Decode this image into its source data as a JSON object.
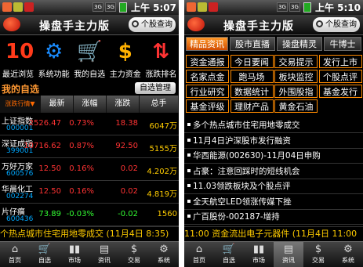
{
  "left": {
    "status_time": "上午 5:07",
    "app_title": "操盘手主力版",
    "search_label": "个股查询",
    "icons": [
      {
        "label": "最近浏览",
        "glyph": "10",
        "color": "#ff3a1a"
      },
      {
        "label": "系统功能",
        "glyph": "⚙",
        "color": "#1a8cff"
      },
      {
        "label": "我的自选",
        "glyph": "🛒",
        "color": "#ffcc00"
      },
      {
        "label": "主力资金",
        "glyph": "$",
        "color": "#ffb000"
      },
      {
        "label": "涨跌排名",
        "glyph": "⇅",
        "color": "#ff3333"
      }
    ],
    "section_title": "我的自选",
    "manage_label": "自选管理",
    "columns": [
      "涨跌行情▼",
      "最新",
      "涨幅",
      "涨跌",
      "总手"
    ],
    "rows": [
      {
        "name": "上证指数",
        "code": "000001",
        "price": "2526.47",
        "pct": "0.73%",
        "chg": "18.38",
        "total": "6047万",
        "dir": "up"
      },
      {
        "name": "深证成指",
        "code": "399001",
        "price": "10716.62",
        "pct": "0.87%",
        "chg": "92.50",
        "total": "5155万",
        "dir": "up"
      },
      {
        "name": "万好万家",
        "code": "600576",
        "price": "12.50",
        "pct": "0.16%",
        "chg": "0.02",
        "total": "4.202万",
        "dir": "up"
      },
      {
        "name": "华晨化工",
        "code": "002274",
        "price": "12.50",
        "pct": "0.16%",
        "chg": "0.02",
        "total": "4.819万",
        "dir": "up"
      },
      {
        "name": "片仔癀",
        "code": "600436",
        "price": "73.89",
        "pct": "-0.03%",
        "chg": "-0.02",
        "total": "1560",
        "dir": "down"
      }
    ],
    "ticker": "个热点城市住宅用地零成交 (11月4日 8:35)",
    "nav": [
      {
        "label": "首页",
        "glyph": "⌂"
      },
      {
        "label": "自选",
        "glyph": "🛒"
      },
      {
        "label": "市场",
        "glyph": "▮▮"
      },
      {
        "label": "资讯",
        "glyph": "▤"
      },
      {
        "label": "交易",
        "glyph": "$"
      },
      {
        "label": "系统",
        "glyph": "⚙"
      }
    ]
  },
  "right": {
    "status_time": "上午 5:10",
    "app_title": "操盘手主力版",
    "search_label": "个股查询",
    "tabs": [
      "精品资讯",
      "股市直播",
      "操盘精灵",
      "牛博士"
    ],
    "grid": [
      [
        "资金通报",
        "今日要闻",
        "交易提示",
        "发行上市"
      ],
      [
        "名家点金",
        "跑马场",
        "板块监控",
        "个股点评"
      ],
      [
        "行业研究",
        "数据统计",
        "外围股指",
        "基金发行"
      ],
      [
        "基金评级",
        "理财产品",
        "黄金石油"
      ]
    ],
    "news": [
      "多个热点城市住宅用地零成交",
      "11月4日沪深股市发行融资",
      "华西能源(002630)-11月04日申购",
      "占豪：注意回踩时的短线机会",
      "11.03领跌板块及个股点评",
      "全天航空LED领涨传媒下挫",
      "广百股份-002187-增持"
    ],
    "ticker": "11:00 资金流出电子元器件 (11月4日 11:00",
    "nav": [
      {
        "label": "首页",
        "glyph": "⌂"
      },
      {
        "label": "自选",
        "glyph": "🛒"
      },
      {
        "label": "市场",
        "glyph": "▮▮"
      },
      {
        "label": "资讯",
        "glyph": "▤"
      },
      {
        "label": "交易",
        "glyph": "$"
      },
      {
        "label": "系统",
        "glyph": "⚙"
      }
    ]
  }
}
